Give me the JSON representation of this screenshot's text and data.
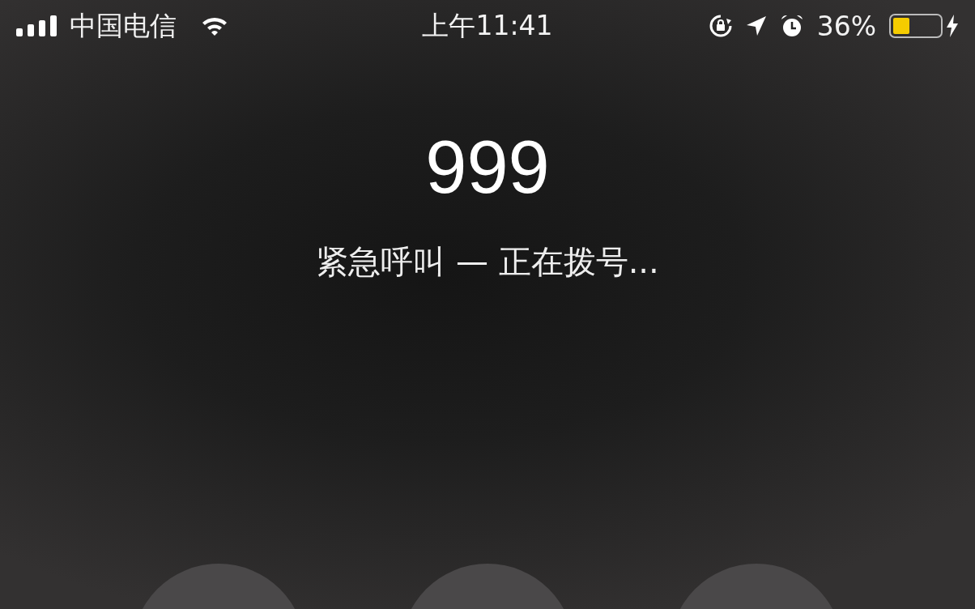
{
  "status_bar": {
    "carrier": "中国电信",
    "time": "上午11:41",
    "battery_percent": "36%",
    "battery": {
      "level": 0.36,
      "low_power_mode": true,
      "charging": true
    }
  },
  "call": {
    "number": "999",
    "status": "紧急呼叫 — 正在拨号..."
  }
}
